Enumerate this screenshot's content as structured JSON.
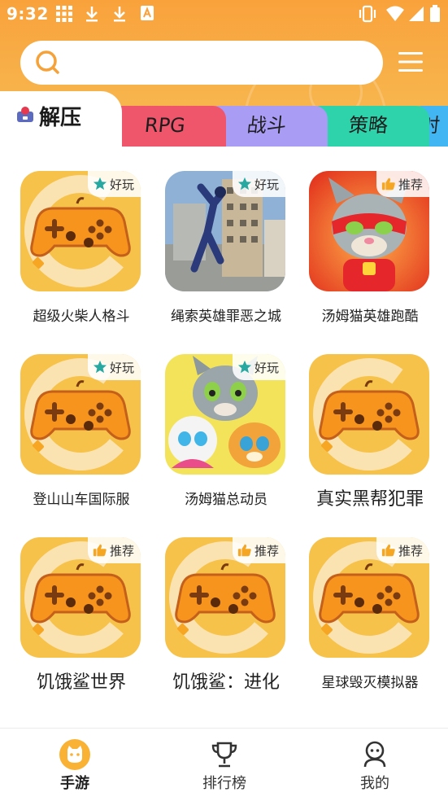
{
  "status_bar": {
    "time": "9:32"
  },
  "search": {
    "placeholder": ""
  },
  "tabs": {
    "active": "解压",
    "items": [
      "RPG",
      "战斗",
      "策略",
      "射"
    ]
  },
  "games": [
    {
      "title": "超级火柴人格斗",
      "badge": "好玩",
      "badge_icon": "star-icon",
      "thumb": "placeholder-gamepad"
    },
    {
      "title": "绳索英雄罪恶之城",
      "badge": "好玩",
      "badge_icon": "star-icon",
      "thumb": "rope-hero-screenshot"
    },
    {
      "title": "汤姆猫英雄跑酷",
      "badge": "推荐",
      "badge_icon": "thumbs-up-icon",
      "thumb": "tom-hero-dash"
    },
    {
      "title": "登山山车国际服",
      "badge": "好玩",
      "badge_icon": "star-icon",
      "thumb": "placeholder-gamepad"
    },
    {
      "title": "汤姆猫总动员",
      "badge": "好玩",
      "badge_icon": "star-icon",
      "thumb": "talking-tom-friends"
    },
    {
      "title": "真实黑帮犯罪",
      "badge": "",
      "badge_icon": "",
      "thumb": "placeholder-gamepad"
    },
    {
      "title": "饥饿鲨世界",
      "badge": "推荐",
      "badge_icon": "thumbs-up-icon",
      "thumb": "placeholder-gamepad"
    },
    {
      "title": "饥饿鲨：进化",
      "badge": "推荐",
      "badge_icon": "thumbs-up-icon",
      "thumb": "placeholder-gamepad"
    },
    {
      "title": "星球毁灭模拟器",
      "badge": "推荐",
      "badge_icon": "thumbs-up-icon",
      "thumb": "placeholder-gamepad"
    }
  ],
  "bottom_nav": {
    "items": [
      {
        "label": "手游",
        "icon": "game-cat-icon",
        "active": true
      },
      {
        "label": "排行榜",
        "icon": "trophy-icon",
        "active": false
      },
      {
        "label": "我的",
        "icon": "profile-icon",
        "active": false
      }
    ]
  },
  "colors": {
    "header": "#f9a23c",
    "tab_rpg": "#f0566b",
    "tab_battle": "#a99cf5",
    "tab_strategy": "#2ed3ac",
    "tab_more": "#41b6f2",
    "placeholder_tile": "#f6c24a",
    "badge_star": "#2aa9a0",
    "badge_thumb": "#f5a623"
  }
}
